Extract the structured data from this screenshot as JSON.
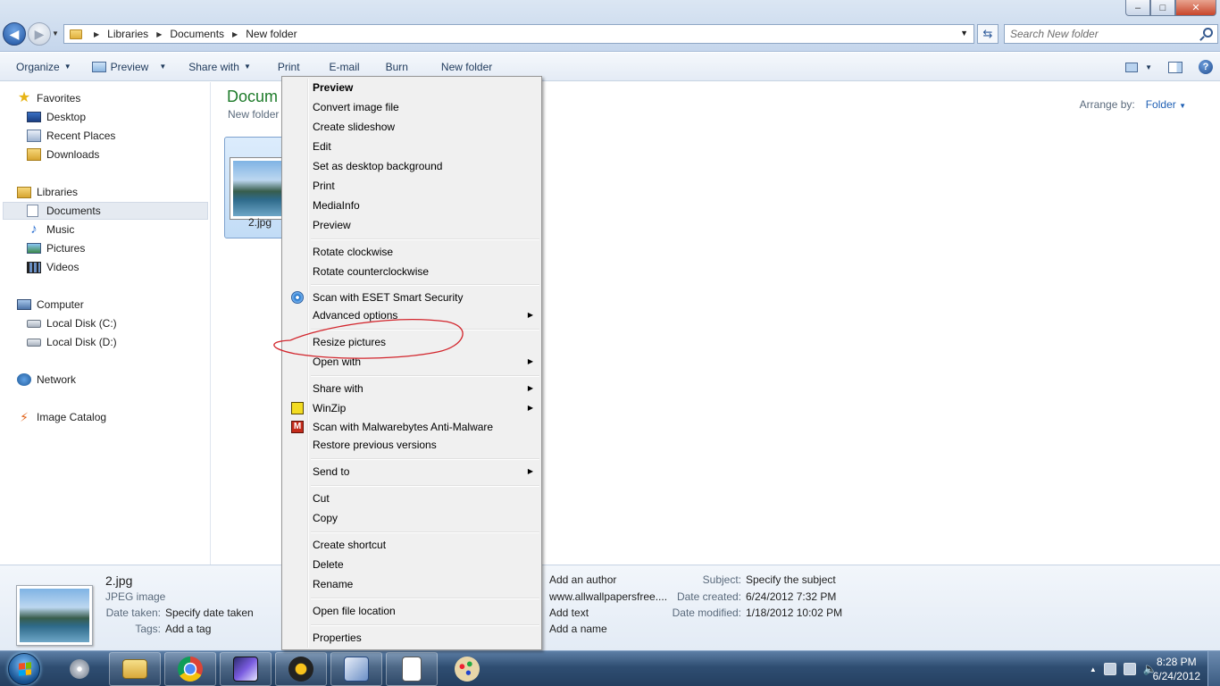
{
  "window": {
    "controls": {
      "minimize": "–",
      "maximize": "□",
      "close": "✕"
    }
  },
  "address": {
    "crumbs": [
      "Libraries",
      "Documents",
      "New folder"
    ],
    "search_placeholder": "Search New folder"
  },
  "toolbar": {
    "organize": "Organize",
    "preview": "Preview",
    "share_with": "Share with",
    "print": "Print",
    "email": "E-mail",
    "burn": "Burn",
    "new_folder": "New folder",
    "help": "?"
  },
  "nav": {
    "favorites": "Favorites",
    "desktop": "Desktop",
    "recent_places": "Recent Places",
    "downloads": "Downloads",
    "libraries": "Libraries",
    "documents": "Documents",
    "music": "Music",
    "pictures": "Pictures",
    "videos": "Videos",
    "computer": "Computer",
    "local_c": "Local Disk (C:)",
    "local_d": "Local Disk (D:)",
    "network": "Network",
    "image_catalog": "Image Catalog"
  },
  "content": {
    "library_title": "Docum",
    "library_sub": "New folder",
    "arrange_label": "Arrange by:",
    "arrange_value": "Folder",
    "file_name": "2.jpg"
  },
  "menu": {
    "items": [
      "Preview",
      "Convert image file",
      "Create slideshow",
      "Edit",
      "Set as desktop background",
      "Print",
      "MediaInfo",
      "Preview",
      "Rotate clockwise",
      "Rotate counterclockwise",
      "Scan with ESET Smart Security",
      "Advanced options",
      "Resize pictures",
      "Open with",
      "Share with",
      "WinZip",
      "Scan with Malwarebytes Anti-Malware",
      "Restore previous versions",
      "Send to",
      "Cut",
      "Copy",
      "Create shortcut",
      "Delete",
      "Rename",
      "Open file location",
      "Properties"
    ]
  },
  "details": {
    "name": "2.jpg",
    "type": "JPEG image",
    "date_taken_label": "Date taken:",
    "date_taken_value": "Specify date taken",
    "tags_label": "Tags:",
    "tags_value": "Add a tag",
    "authors_value": "Add an author",
    "title_value": "www.allwallpapersfree....",
    "comments_value": "Add text",
    "name_value": "Add a name",
    "subject_label": "Subject:",
    "subject_value": "Specify the subject",
    "created_label": "Date created:",
    "created_value": "6/24/2012 7:32 PM",
    "modified_label": "Date modified:",
    "modified_value": "1/18/2012 10:02 PM"
  },
  "taskbar": {
    "time": "8:28 PM",
    "date": "6/24/2012"
  },
  "colors": {
    "library_title": "#1e7b2a",
    "link_blue": "#1e5fb4",
    "annotation_red": "#d2242b"
  }
}
